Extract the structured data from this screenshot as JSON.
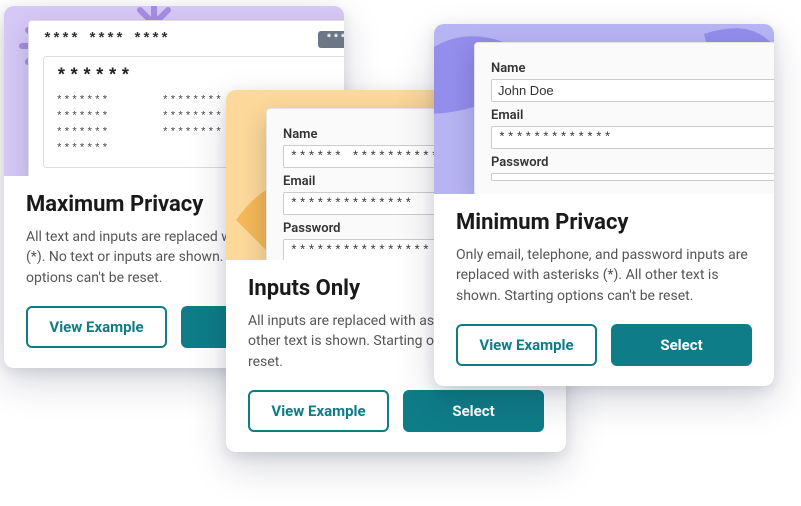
{
  "common": {
    "view_example": "View Example",
    "select": "Select"
  },
  "max": {
    "title": "Maximum Privacy",
    "desc": "All text and inputs are replaced with asterisks (*). No text or inputs are shown. Starting options can't be reset.",
    "mock": {
      "top_masked": "**** **** ****",
      "badge": "*****",
      "heading_masked": "******",
      "cells": [
        "*******",
        "********",
        "******",
        "*******",
        "********",
        "******",
        "*******",
        "********",
        "******",
        "*******",
        "",
        "******"
      ]
    }
  },
  "inp": {
    "title": "Inputs Only",
    "desc": "All inputs are replaced with asterisks (*). All other text is shown. Starting options can't be reset.",
    "form": {
      "name_label": "Name",
      "name_value": "******  **********",
      "email_label": "Email",
      "email_value": "**************",
      "password_label": "Password",
      "password_value": "****************"
    }
  },
  "min": {
    "title": "Minimum Privacy",
    "desc": "Only email, telephone, and password inputs are replaced with asterisks (*). All other text is shown. Starting options can't be reset.",
    "form": {
      "name_label": "Name",
      "name_value": "John  Doe",
      "email_label": "Email",
      "email_value": "*************",
      "password_label": "Password",
      "password_value": ""
    }
  }
}
